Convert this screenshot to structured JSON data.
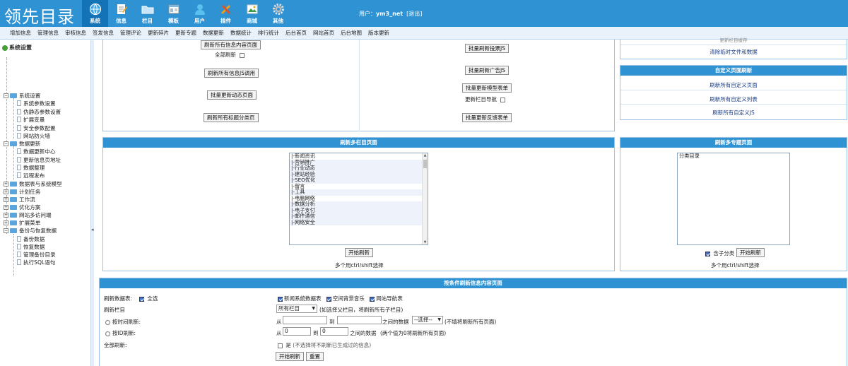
{
  "header": {
    "logo": "领先目录",
    "user_prefix": "用户：",
    "user_name": "ym3_net",
    "logout": "[退出]",
    "nav": [
      {
        "label": "系统",
        "icon": "globe-icon"
      },
      {
        "label": "信息",
        "icon": "edit-icon"
      },
      {
        "label": "栏目",
        "icon": "folder-icon"
      },
      {
        "label": "模板",
        "icon": "template-icon"
      },
      {
        "label": "用户",
        "icon": "user-icon"
      },
      {
        "label": "插件",
        "icon": "tools-icon"
      },
      {
        "label": "商城",
        "icon": "shop-icon"
      },
      {
        "label": "其他",
        "icon": "gear-icon"
      }
    ]
  },
  "menubar": [
    "增加信息",
    "管理信息",
    "审核信息",
    "签发信息",
    "管理评论",
    "更新碎片",
    "更新专题",
    "数据更新",
    "数据统计",
    "排行统计",
    "后台首页",
    "网站首页",
    "后台地图",
    "版本更新"
  ],
  "sidebar": {
    "root": "系统设置",
    "items": [
      "系统设置",
      "系统参数设置",
      "伪静态参数设置",
      "扩展变量",
      "安全参数配置",
      "网站防火墙",
      "数据更新",
      "数据更新中心",
      "更新信息页地址",
      "数据整理",
      "远程发布",
      "数据表与系统模型",
      "计划任务",
      "工作流",
      "优化方案",
      "网站多访问端",
      "扩展菜单",
      "备份与恢复数据",
      "备份数据",
      "恢复数据",
      "管理备份目录",
      "执行SQL语句"
    ]
  },
  "top_left_panel": {
    "btn_content": "刷新所有信息内容页面",
    "all_refresh": "全部刷新",
    "btn_js": "刷新所有信息JS调用",
    "btn_dynamic": "批量更新动态页面",
    "btn_tag": "刷新所有标题分类页"
  },
  "top_mid_panel": {
    "btn_vote": "批量刷新投票JS",
    "btn_ad": "批量刷新广告JS",
    "btn_model_form": "批量更新模型表单",
    "update_nav": "更新栏目导航",
    "btn_feedback": "批量更新反馈表单"
  },
  "top_right_panel": {
    "link_top_partial": "更新栏目缓存",
    "link_clear": "清除临时文件和数据",
    "custom_title": "自定义页面刷新",
    "custom_links": [
      "刷新所有自定义页面",
      "刷新所有自定义列表",
      "刷新所有自定义JS"
    ]
  },
  "multi_column_panel": {
    "title": "刷新多栏目页面",
    "options": [
      "|-新闻资讯",
      "|-营销推广",
      "|-行业动态",
      "|-建站经验",
      "|-SEO优化",
      "|-留言",
      "|-工具",
      "|-电脑网络",
      "|-数据分析",
      "|-电子支付",
      "|-邮件通信",
      "|-网络安全"
    ],
    "start_btn": "开始刷新",
    "hint": "多个用ctrl/shift选择"
  },
  "multi_topic_panel": {
    "title": "刷新多专题页面",
    "options": [
      "分类目录"
    ],
    "include_sub": "含子分类",
    "start_btn": "开始刷新",
    "hint": "多个用ctrl/shift选择"
  },
  "condition_panel": {
    "title": "按条件刷新信息内容页面",
    "row_tables_label": "刷新数据表:",
    "select_all": "全选",
    "tables": [
      "新闻系统数据表",
      "空间背景音乐",
      "网站导航表"
    ],
    "row_column_label": "刷新栏目",
    "column_select": "所有栏目",
    "column_hint": "(如选择父栏目，将刷新所有子栏目)",
    "by_time_label": "按时间刷新:",
    "from": "从",
    "to": "到",
    "time_between": "之间的数据",
    "time_select": "--选择--",
    "time_hint": "(不填将刷新所有页面)",
    "by_id_label": "按ID刷新:",
    "id_from": "0",
    "id_to": "0",
    "id_between": "之间的数据",
    "id_hint": "(两个值为0将刷新所有页面)",
    "all_refresh_label": "全部刷新:",
    "yes": "是",
    "yes_hint": "(不选择将不刷新已生成过的信息)",
    "start_btn": "开始刷新",
    "reset_btn": "重置"
  },
  "colors": {
    "header": "#2f93d3",
    "active_nav": "#1473b7",
    "panel_border": "#9cc3e4"
  }
}
